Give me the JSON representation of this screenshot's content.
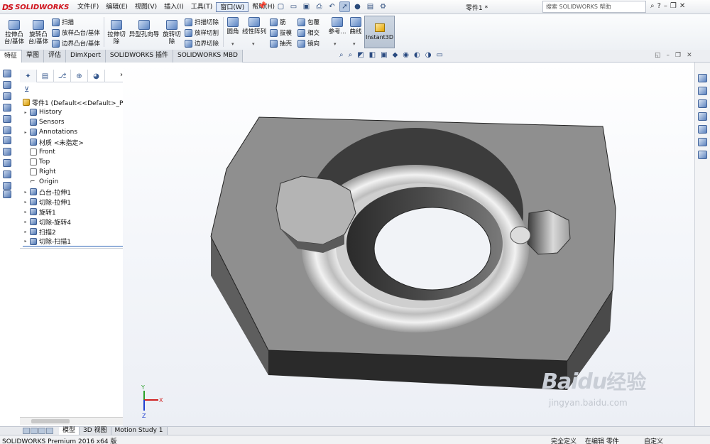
{
  "brand": {
    "name": "SOLIDWORKS",
    "mark": "DS"
  },
  "menu": [
    "文件(F)",
    "编辑(E)",
    "视图(V)",
    "插入(I)",
    "工具(T)",
    "窗口(W)",
    "帮助(H)"
  ],
  "document_title": "零件1 *",
  "search": {
    "placeholder": "搜索 SOLIDWORKS 帮助"
  },
  "ribbon": {
    "extrude_boss": "拉伸凸台/基体",
    "revolve_boss": "旋转凸台/基体",
    "sweep": "扫描",
    "loft_boss": "放样凸台/基体",
    "boundary_boss": "边界凸台/基体",
    "extrude_cut": "拉伸切除",
    "hole_wizard": "异型孔向导",
    "revolve_cut": "旋转切除",
    "sweep_cut": "扫描切除",
    "loft_cut": "放样切割",
    "boundary_cut": "边界切除",
    "fillet": "圆角",
    "linear_pattern": "线性阵列",
    "rib": "筋",
    "draft": "拔模",
    "shell": "抽壳",
    "wrap": "包覆",
    "intersect": "相交",
    "mirror": "镜向",
    "reference": "参考...",
    "curves": "曲线",
    "instant3d": "Instant3D"
  },
  "command_tabs": [
    "特征",
    "草图",
    "评估",
    "DimXpert",
    "SOLIDWORKS 插件",
    "SOLIDWORKS MBD"
  ],
  "feature_tree": {
    "root": "零件1 (Default<<Default>_Ph",
    "items": [
      {
        "label": "History",
        "expand": "▸"
      },
      {
        "label": "Sensors",
        "expand": ""
      },
      {
        "label": "Annotations",
        "expand": "▸"
      },
      {
        "label": "材质 <未指定>",
        "expand": ""
      },
      {
        "label": "Front",
        "expand": ""
      },
      {
        "label": "Top",
        "expand": ""
      },
      {
        "label": "Right",
        "expand": ""
      },
      {
        "label": "Origin",
        "expand": ""
      },
      {
        "label": "凸台-拉伸1",
        "expand": "▸"
      },
      {
        "label": "切除-拉伸1",
        "expand": "▸"
      },
      {
        "label": "旋转1",
        "expand": "▸"
      },
      {
        "label": "切除-旋转4",
        "expand": "▸"
      },
      {
        "label": "扫描2",
        "expand": "▸"
      },
      {
        "label": "切除-扫描1",
        "expand": "▸"
      }
    ]
  },
  "watermark": {
    "logo": "Bai",
    "logo2": "du",
    "cn": "经验",
    "url": "jingyan.baidu.com"
  },
  "bottom_tabs": [
    "模型",
    "3D 视图",
    "Motion Study 1"
  ],
  "status": {
    "product": "SOLIDWORKS Premium 2016 x64 版",
    "defined": "完全定义",
    "editing": "在编辑 零件",
    "custom": "自定义"
  },
  "triad": {
    "x": "X",
    "y": "Y",
    "z": "Z"
  },
  "colors": {
    "accent": "#2f65b8",
    "part_face": "#8f8f8f",
    "part_side": "#6a6a6a"
  }
}
